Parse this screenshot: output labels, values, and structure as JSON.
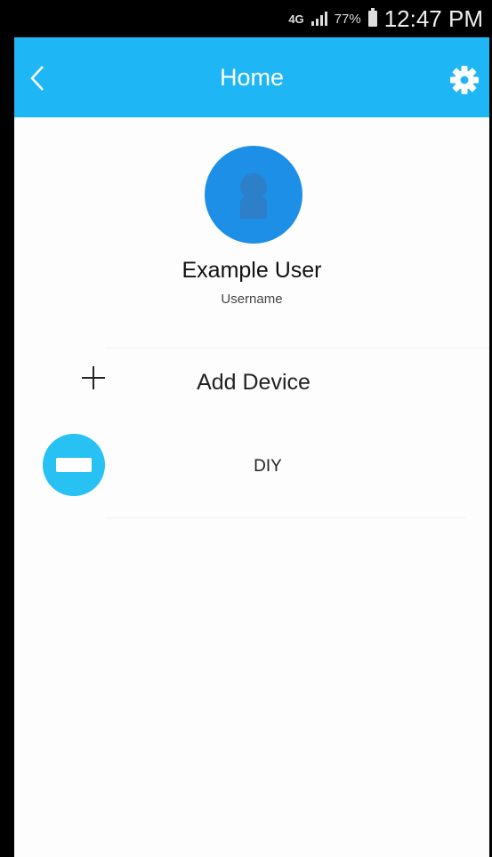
{
  "status_bar": {
    "network": "4G",
    "battery_percent": "77%",
    "time": "12:47 PM"
  },
  "app_bar": {
    "title": "Home",
    "back_icon": "chevron-left-icon",
    "settings_icon": "gear-icon",
    "background_color": "#1fb6f5"
  },
  "profile": {
    "avatar_icon": "user-silhouette-icon",
    "avatar_color": "#1e8fe6",
    "display_name": "Example User",
    "username": "Username"
  },
  "menu": {
    "add_device_label": "Add Device",
    "add_icon": "plus-icon",
    "devices": [
      {
        "label": "DIY",
        "icon": "device-icon",
        "color": "#27c1f3"
      }
    ]
  }
}
